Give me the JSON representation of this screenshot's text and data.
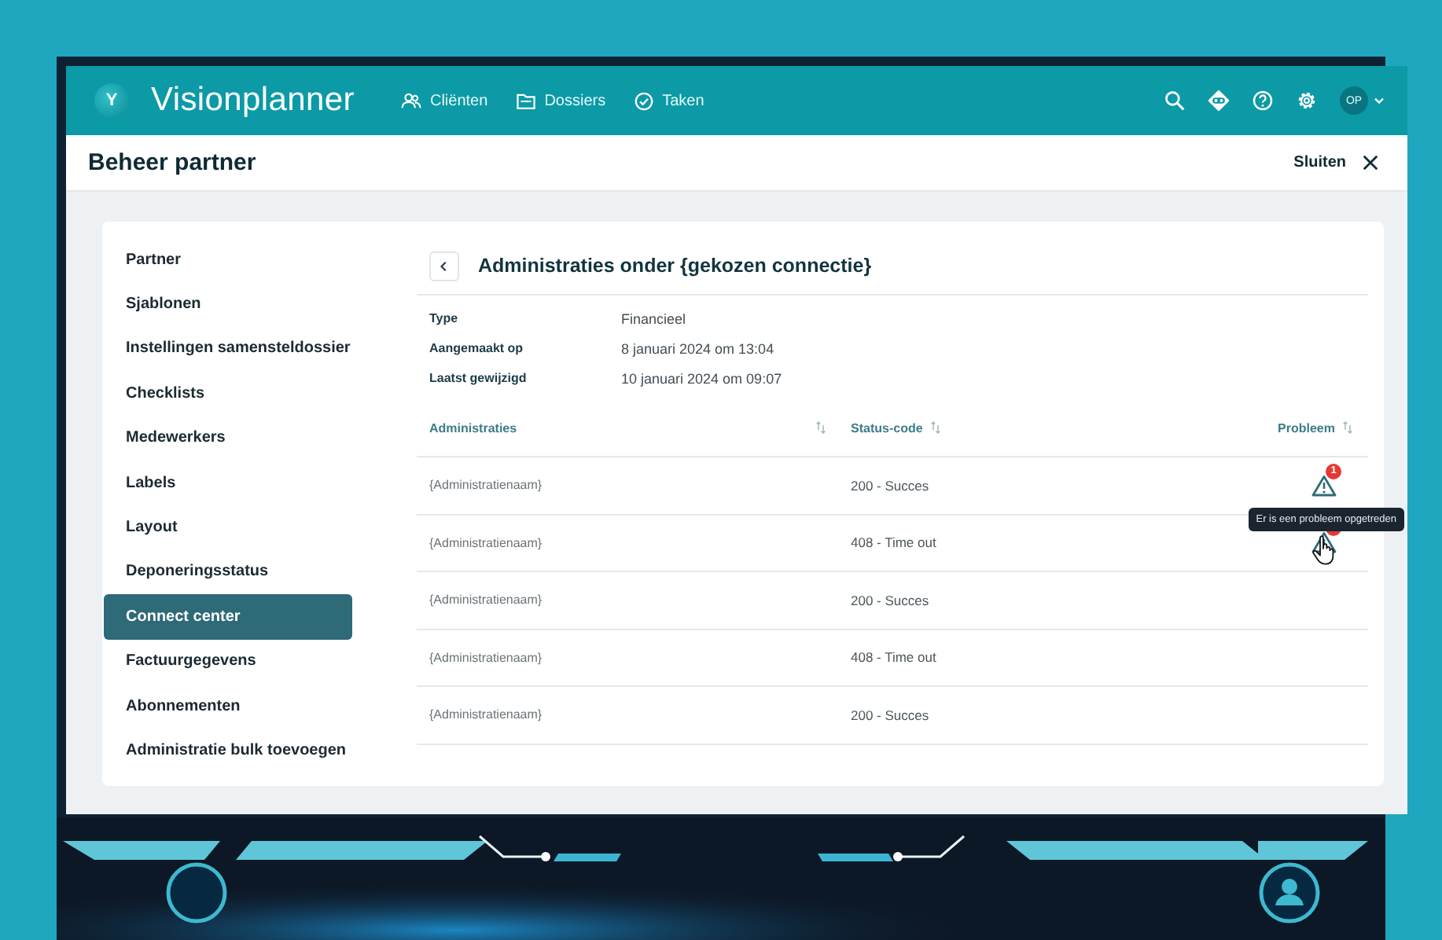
{
  "app": {
    "logo_mark": "Y",
    "name": "Visionplanner"
  },
  "nav": [
    {
      "label": "Cliënten"
    },
    {
      "label": "Dossiers"
    },
    {
      "label": "Taken"
    }
  ],
  "user": {
    "initials": "OP"
  },
  "page": {
    "title": "Beheer partner",
    "close_label": "Sluiten"
  },
  "sidebar": {
    "items": [
      {
        "label": "Partner",
        "selected": false
      },
      {
        "label": "Sjablonen",
        "selected": false
      },
      {
        "label": "Instellingen samensteldossier",
        "selected": false
      },
      {
        "label": "Checklists",
        "selected": false
      },
      {
        "label": "Medewerkers",
        "selected": false
      },
      {
        "label": "Labels",
        "selected": false
      },
      {
        "label": "Layout",
        "selected": false
      },
      {
        "label": "Deponeringsstatus",
        "selected": false
      },
      {
        "label": "Connect center",
        "selected": true
      },
      {
        "label": "Factuurgegevens",
        "selected": false
      },
      {
        "label": "Abonnementen",
        "selected": false
      },
      {
        "label": "Administratie bulk toevoegen",
        "selected": false
      }
    ]
  },
  "detail": {
    "title": "Administraties onder {gekozen connectie}",
    "fields": [
      {
        "label": "Type",
        "value": "Financieel"
      },
      {
        "label": "Aangemaakt op",
        "value": "8 januari 2024 om 13:04"
      },
      {
        "label": "Laatst gewijzigd",
        "value": "10 januari 2024 om 09:07"
      }
    ]
  },
  "table": {
    "columns": [
      "Administraties",
      "Status-code",
      "Probleem"
    ],
    "rows": [
      {
        "name": "{Administratienaam}",
        "status": "200 - Succes",
        "problem": true,
        "badge": "1",
        "hovered": false
      },
      {
        "name": "{Administratienaam}",
        "status": "408 - Time out",
        "problem": true,
        "hovered": true,
        "tooltip": "Er is een probleem opgetreden"
      },
      {
        "name": "{Administratienaam}",
        "status": "200 - Succes",
        "problem": false,
        "hovered": false
      },
      {
        "name": "{Administratienaam}",
        "status": "408 - Time out",
        "problem": false,
        "hovered": false
      },
      {
        "name": "{Administratienaam}",
        "status": "200 - Succes",
        "problem": false,
        "hovered": false
      }
    ]
  }
}
